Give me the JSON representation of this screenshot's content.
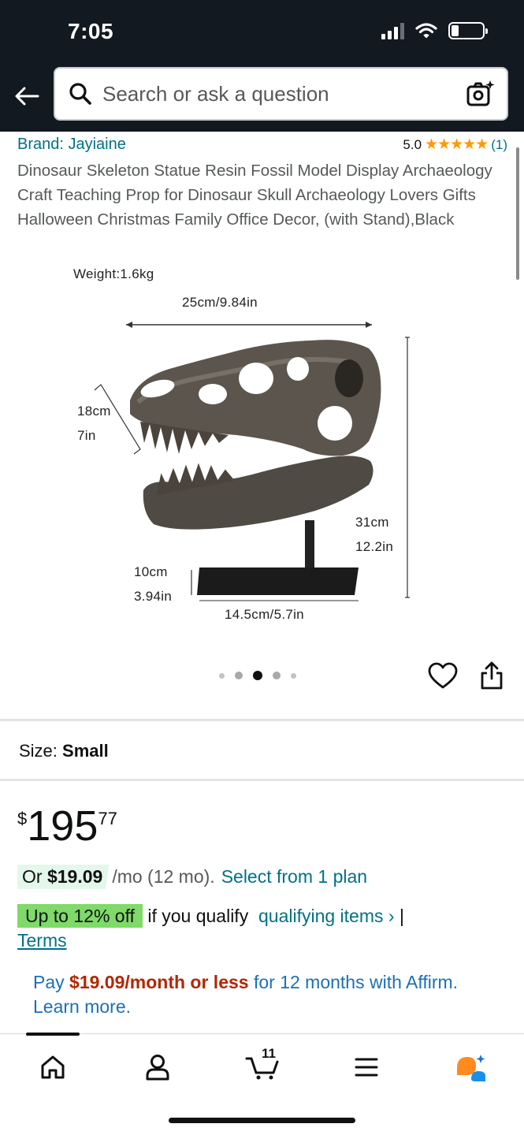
{
  "status_bar": {
    "time": "7:05"
  },
  "header": {
    "search_placeholder": "Search or ask a question",
    "icons": [
      "back-arrow-icon",
      "search-icon",
      "camera-icon"
    ]
  },
  "product": {
    "brand": "Brand: Jayiaine",
    "rating": {
      "score": "5.0",
      "stars": "★★★★★",
      "count": "(1)"
    },
    "title": "Dinosaur Skeleton Statue Resin Fossil Model Display Archaeology Craft Teaching Prop for Dinosaur Skull Archaeology Lovers Gifts Halloween Christmas Family Office Decor, (with Stand),Black"
  },
  "image": {
    "weight": "Weight:1.6kg",
    "width": "25cm/9.84in",
    "depth_cm": "18cm",
    "depth_in": "7in",
    "height_cm": "31cm",
    "height_in": "12.2in",
    "base_height_cm": "10cm",
    "base_height_in": "3.94in",
    "base_width": "14.5cm/5.7in",
    "carousel": {
      "total": 5,
      "active_index": 2
    }
  },
  "size": {
    "label": "Size:",
    "value": "Small"
  },
  "price": {
    "symbol": "$",
    "whole": "195",
    "fraction": "77"
  },
  "monthly": {
    "prefix": "Or ",
    "amount": "$19.09",
    "term": "/mo (12 mo).",
    "select": "Select from 1 plan"
  },
  "promo": {
    "badge": "Up to 12% off",
    "text": "if you qualify",
    "link": "qualifying items ›",
    "separator": "|",
    "terms": "Terms"
  },
  "affirm": {
    "pay": "Pay ",
    "amount": "$19.09/month or less",
    "rest": " for 12 months with Affirm. Learn more."
  },
  "bottom_nav": {
    "cart_count": "11",
    "items": [
      "home-icon",
      "account-icon",
      "cart-icon",
      "menu-icon",
      "rufus-icon"
    ],
    "colors": {
      "rufus_orange": "#ff8a1d",
      "rufus_blue": "#1a8fe8"
    }
  },
  "colors": {
    "header_bg": "#131921",
    "link": "#007185",
    "star": "#ff9900",
    "deal_badge": "#7fda69",
    "monthly_bg": "#e3f7ea",
    "price_red": "#b12704"
  }
}
